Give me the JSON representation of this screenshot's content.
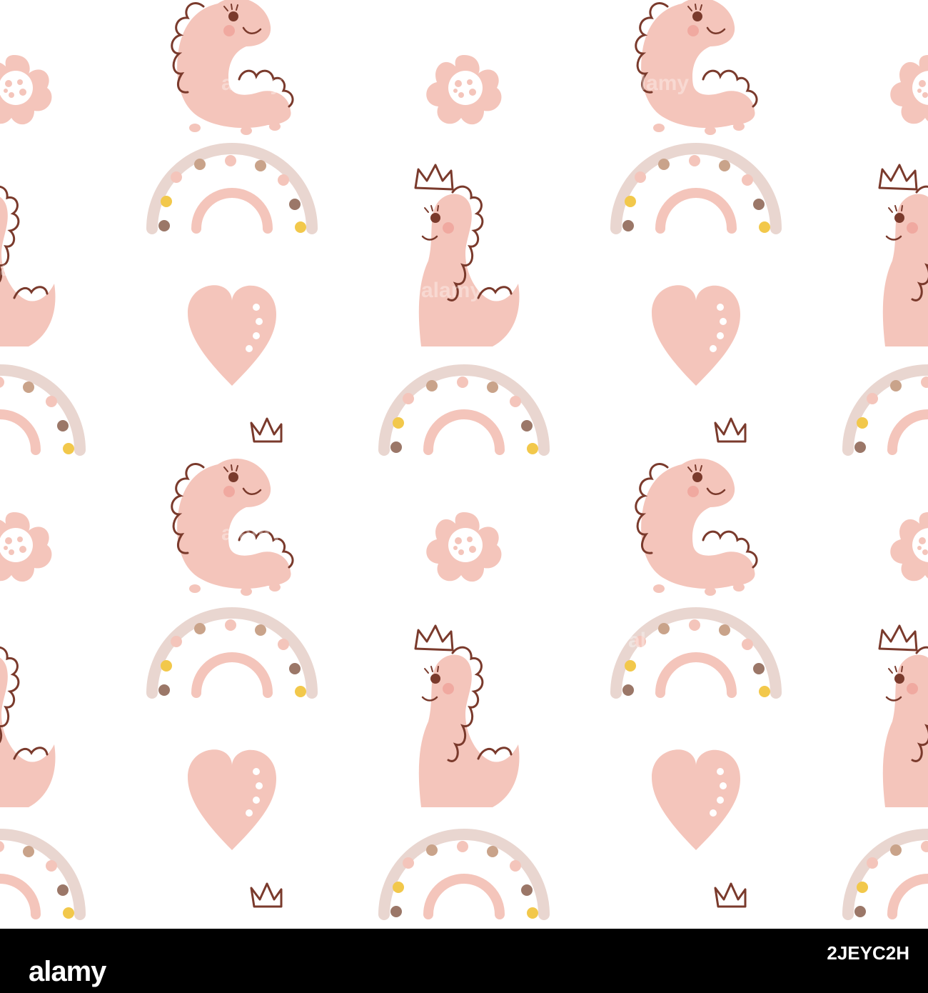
{
  "colors": {
    "background": "#ffffff",
    "pink": "#f4c5bb",
    "outline": "#7a3a2c",
    "rainbow_outer": "#e9d6d0",
    "rainbow_inner": "#f4c5bb",
    "dot_pink": "#f4c5bb",
    "dot_brown": "#9b7768",
    "dot_tan": "#c9a38a",
    "dot_yellow": "#f2c84b",
    "cheek": "#f0a9a0",
    "bar": "#000000"
  },
  "icons": {
    "motif_dino_crown": "dinosaur-crown-icon",
    "motif_dino_sitting": "dinosaur-sitting-icon",
    "motif_rainbow": "rainbow-icon",
    "motif_heart": "heart-icon",
    "motif_flower": "flower-icon"
  },
  "watermark": {
    "brand": "alamy",
    "image_id": "2JEYC2H",
    "overlay_text": "alamy"
  }
}
